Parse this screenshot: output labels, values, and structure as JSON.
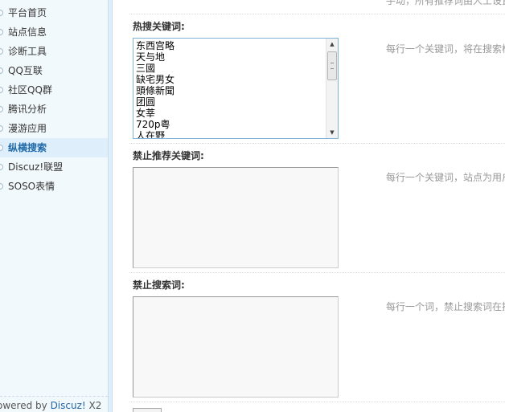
{
  "sidebar": {
    "items": [
      {
        "label": "平台首页",
        "active": false
      },
      {
        "label": "站点信息",
        "active": false
      },
      {
        "label": "诊断工具",
        "active": false
      },
      {
        "label": "QQ互联",
        "active": false
      },
      {
        "label": "社区QQ群",
        "active": false
      },
      {
        "label": "腾讯分析",
        "active": false
      },
      {
        "label": "漫游应用",
        "active": false
      },
      {
        "label": "纵横搜索",
        "active": true
      },
      {
        "label": "Discuz!联盟",
        "active": false
      },
      {
        "label": "SOSO表情",
        "active": false
      }
    ],
    "footer": {
      "text": "owered by ",
      "link": "Discuz!",
      "version": " X2"
    }
  },
  "main": {
    "top_note": "手动，所有推荐词由人工设置",
    "hot_keywords": {
      "label": "热搜关键词:",
      "values": [
        "东西宫略",
        "天与地",
        "三國",
        "缺宅男女",
        "頭條新聞",
        "团圆",
        "女莘",
        "720p粤",
        "人在野"
      ],
      "hint": "每行一个关键词，将在搜索框"
    },
    "blocked_recommend": {
      "label": "禁止推荐关键词:",
      "value": "",
      "hint": "每行一个关键词，站点为用户"
    },
    "blocked_search": {
      "label": "禁止搜索词:",
      "value": "",
      "hint": "每行一个词，禁止搜索词在搜"
    }
  }
}
